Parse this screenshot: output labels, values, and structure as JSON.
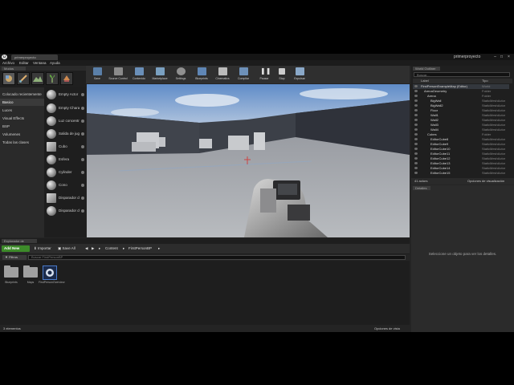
{
  "titlebar": {
    "logo": "U",
    "document_tab": "primerproyecto",
    "project_name": "primerproyecto",
    "min": "–",
    "max": "□",
    "close": "×"
  },
  "menu": [
    "Archivo",
    "Editar",
    "Ventana",
    "Ayuda"
  ],
  "modes": {
    "tab": "Modos",
    "categories": [
      "Colocado recientemente",
      "Basico",
      "Luces",
      "Visual Effects",
      "BSP",
      "Volumenes",
      "Todas las clases"
    ],
    "actors": [
      "Empty Actor",
      "Empty Character",
      "Luz concentrada",
      "Salida de jugador",
      "Cubo",
      "Esfera",
      "Cylinder",
      "Cono",
      "Disparador de caja",
      "Disparador de esfera"
    ]
  },
  "toolbar": {
    "buttons": [
      "Save",
      "Source Control",
      "Contenido",
      "Marketplace",
      "Settings",
      "Blueprints",
      "Cinematics",
      "Compilar",
      "Pausar",
      "Stop",
      "Expulsar"
    ]
  },
  "outliner": {
    "tab": "World Outliner",
    "search_placeholder": "Buscar...",
    "col_label": "Label",
    "col_type": "Tipo",
    "rows": [
      {
        "name": "FirstPersonExampleMap (Editor)",
        "type": "World"
      },
      {
        "name": "ArenaGeometry",
        "type": "Folder"
      },
      {
        "name": "Arena",
        "type": "Folder"
      },
      {
        "name": "BigWall",
        "type": "StaticMeshActor"
      },
      {
        "name": "BigWall2",
        "type": "StaticMeshActor"
      },
      {
        "name": "Floor",
        "type": "StaticMeshActor"
      },
      {
        "name": "Wall1",
        "type": "StaticMeshActor"
      },
      {
        "name": "Wall2",
        "type": "StaticMeshActor"
      },
      {
        "name": "Wall3",
        "type": "StaticMeshActor"
      },
      {
        "name": "Wall4",
        "type": "StaticMeshActor"
      },
      {
        "name": "Cubes",
        "type": "Folder"
      },
      {
        "name": "EditorCube8",
        "type": "StaticMeshActor"
      },
      {
        "name": "EditorCube9",
        "type": "StaticMeshActor"
      },
      {
        "name": "EditorCube10",
        "type": "StaticMeshActor"
      },
      {
        "name": "EditorCube11",
        "type": "StaticMeshActor"
      },
      {
        "name": "EditorCube12",
        "type": "StaticMeshActor"
      },
      {
        "name": "EditorCube13",
        "type": "StaticMeshActor"
      },
      {
        "name": "EditorCube14",
        "type": "StaticMeshActor"
      },
      {
        "name": "EditorCube15",
        "type": "StaticMeshActor"
      }
    ],
    "count": "41 actors",
    "view_options": "Opciones de visualización"
  },
  "details": {
    "tab": "Detalles",
    "empty_message": "Seleccione un objeto para ver los detalles."
  },
  "content_browser": {
    "tab": "Explorador de contenido",
    "add_new": "Add New",
    "import": "Importar",
    "save_all": "Save All",
    "path": [
      "Content",
      "FirstPersonBP"
    ],
    "filters": "Filtros",
    "search_placeholder": "Buscar FirstPersonBP",
    "assets": [
      "Blueprints",
      "Maps",
      "FirstPersonOverview"
    ],
    "count": "3 elementos",
    "view_options": "Opciones de vista"
  }
}
